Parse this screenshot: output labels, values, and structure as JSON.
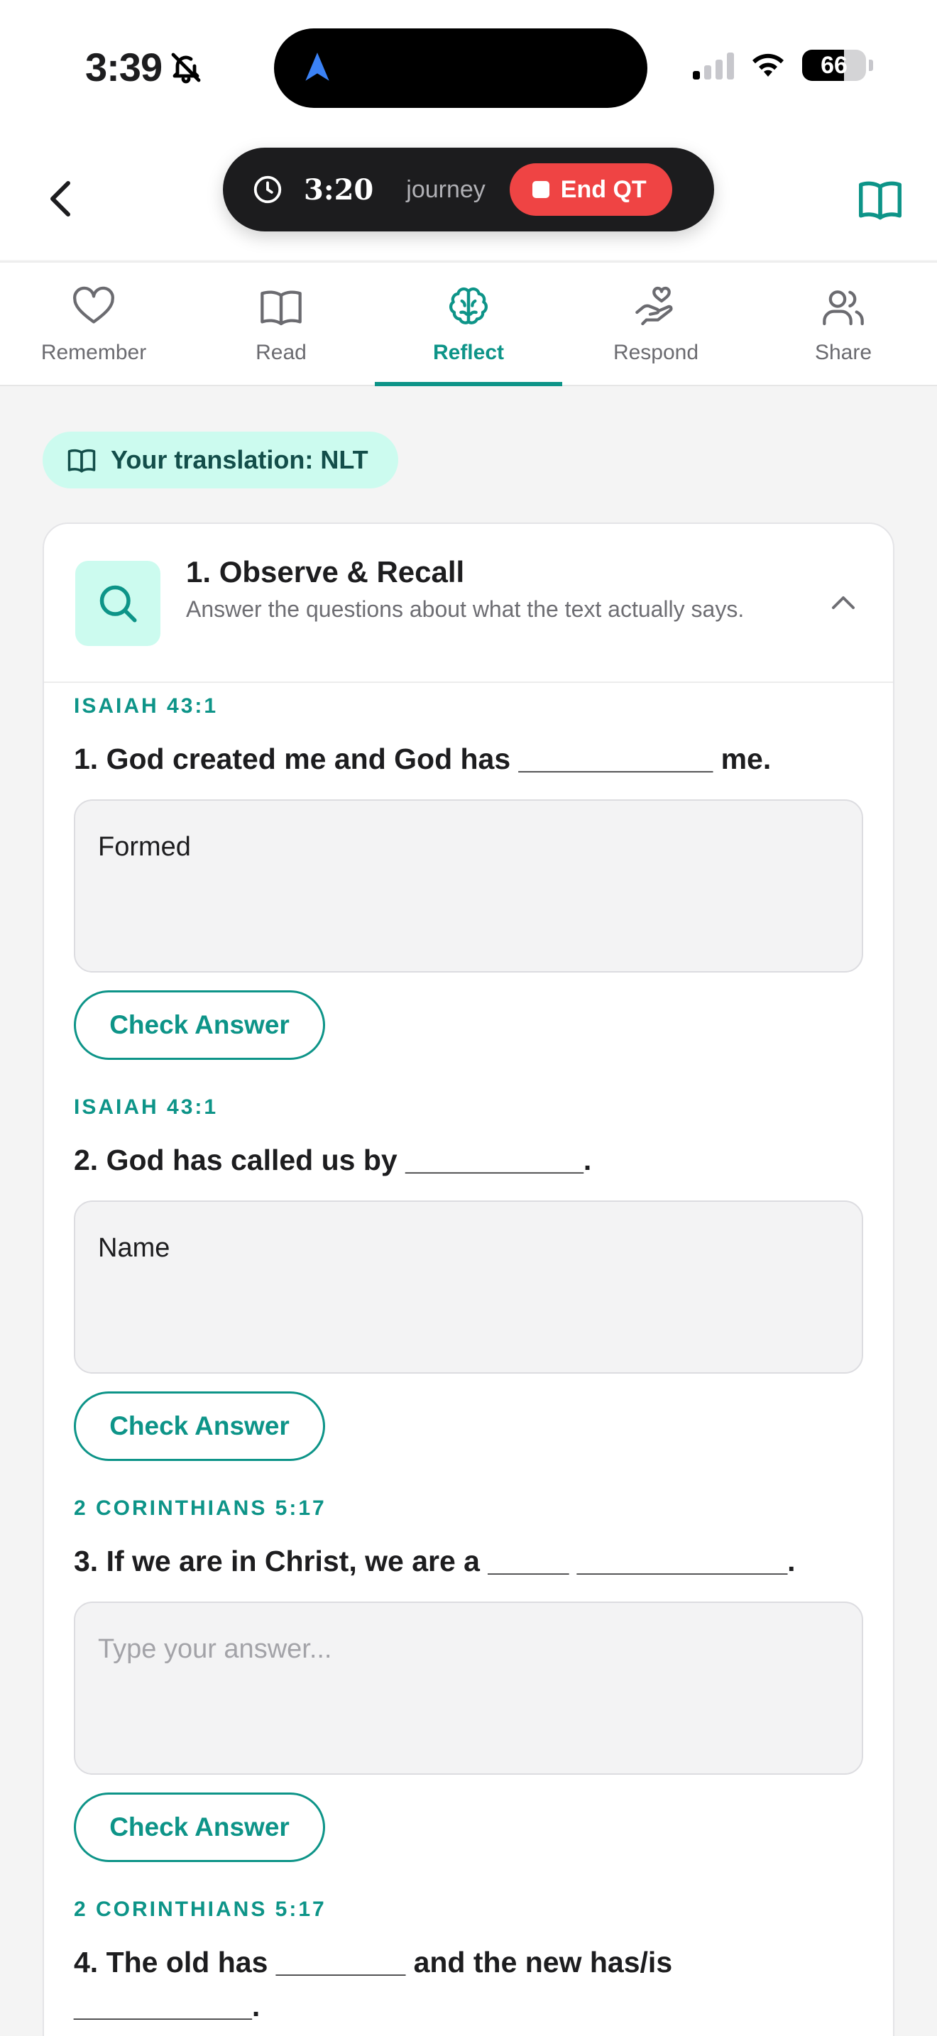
{
  "status_bar": {
    "time": "3:39",
    "battery": "66",
    "signal_bars_active": 1
  },
  "timer": {
    "elapsed": "3:20",
    "mode": "journey",
    "end_label": "End QT"
  },
  "tabs": [
    {
      "label": "Remember",
      "icon": "heart-icon",
      "active": false
    },
    {
      "label": "Read",
      "icon": "book-icon",
      "active": false
    },
    {
      "label": "Reflect",
      "icon": "brain-icon",
      "active": true
    },
    {
      "label": "Respond",
      "icon": "hand-heart-icon",
      "active": false
    },
    {
      "label": "Share",
      "icon": "users-icon",
      "active": false
    }
  ],
  "translation": {
    "label": "Your translation: NLT"
  },
  "section": {
    "title": "1. Observe & Recall",
    "subtitle": "Answer the questions about what the text actually says."
  },
  "questions": [
    {
      "reference": "ISAIAH 43:1",
      "text": "1. God created me and God has ____________ me.",
      "answer": "Formed",
      "placeholder": "Type your answer...",
      "button": "Check Answer"
    },
    {
      "reference": "ISAIAH 43:1",
      "text": "2. God has called us by ___________.",
      "answer": "Name",
      "placeholder": "Type your answer...",
      "button": "Check Answer"
    },
    {
      "reference": "2 CORINTHIANS 5:17",
      "text": "3. If we are in Christ, we are a _____ _____________.",
      "answer": "",
      "placeholder": "Type your answer...",
      "button": "Check Answer"
    },
    {
      "reference": "2 CORINTHIANS 5:17",
      "text": "4. The old has ________ and the new has/is ___________."
    }
  ],
  "colors": {
    "accent": "#0d9488",
    "accent_light": "#ccfbef",
    "end_button": "#ef4444",
    "pill_bg": "#1c1c1e"
  }
}
